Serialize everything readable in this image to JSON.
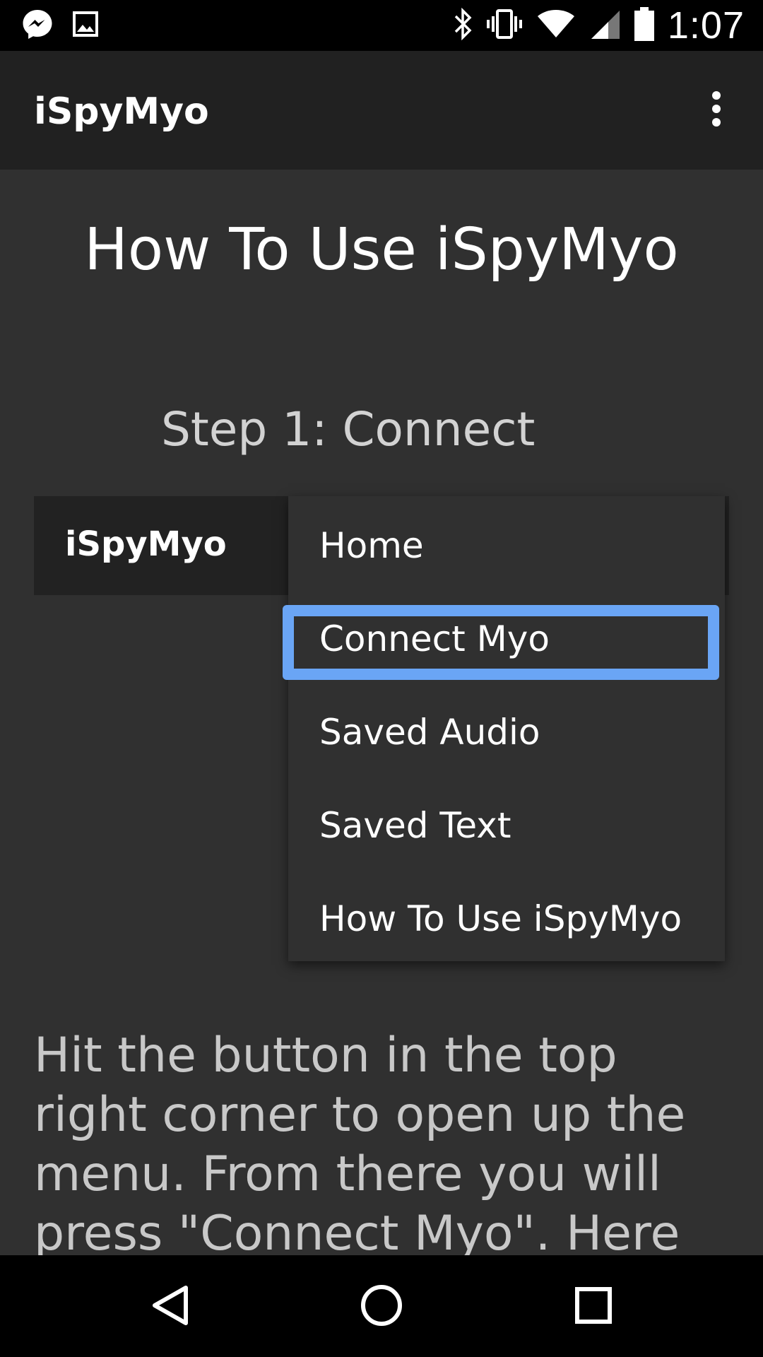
{
  "status_bar": {
    "time": "1:07",
    "icons_left": [
      "messenger-icon",
      "image-icon"
    ],
    "icons_right": [
      "bluetooth-icon",
      "vibrate-icon",
      "wifi-icon",
      "signal-icon",
      "battery-icon"
    ]
  },
  "app_bar": {
    "title": "iSpyMyo",
    "overflow_icon": "overflow-menu-icon"
  },
  "content": {
    "title": "How To Use iSpyMyo",
    "step_title": "Step 1: Connect",
    "image": {
      "app_title": "iSpyMyo",
      "menu_items": [
        "Home",
        "Connect Myo",
        "Saved Audio",
        "Saved Text",
        "How To Use iSpyMyo"
      ],
      "highlighted_item": "Connect Myo",
      "highlight_color": "#6aa5f5"
    },
    "body_text": "Hit the button in the top right corner to open up the menu. From there you will press \"Connect Myo\". Here you will"
  },
  "nav_bar": {
    "buttons": [
      "back-icon",
      "home-icon",
      "recents-icon"
    ]
  },
  "colors": {
    "background": "#303030",
    "app_bar": "#212121",
    "accent": "#6aa5f5"
  }
}
